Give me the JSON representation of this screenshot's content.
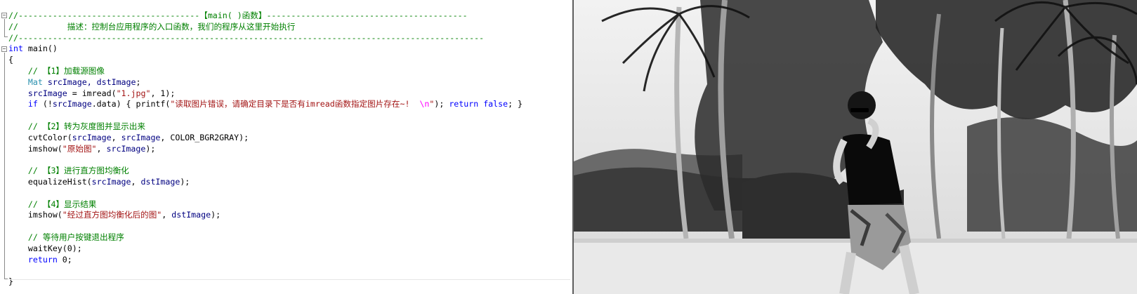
{
  "editor": {
    "fold_markers": [
      "−",
      "−"
    ],
    "lines": [
      {
        "segments": [
          {
            "cls": "c",
            "text": "//-------------------------------------【main( )函数】-----------------------------------------"
          }
        ]
      },
      {
        "segments": [
          {
            "cls": "c",
            "text": "//          描述：控制台应用程序的入口函数，我们的程序从这里开始执行"
          }
        ]
      },
      {
        "segments": [
          {
            "cls": "c",
            "text": "//-----------------------------------------------------------------------------------------------"
          }
        ]
      },
      {
        "segments": [
          {
            "cls": "k",
            "text": "int"
          },
          {
            "cls": "p",
            "text": " main()"
          }
        ]
      },
      {
        "segments": [
          {
            "cls": "p",
            "text": "{"
          }
        ]
      },
      {
        "segments": [
          {
            "cls": "c",
            "text": "    // 【1】加载源图像"
          }
        ]
      },
      {
        "segments": [
          {
            "cls": "t",
            "text": "    Mat"
          },
          {
            "cls": "v",
            "text": " srcImage, dstImage"
          },
          {
            "cls": "p",
            "text": ";"
          }
        ]
      },
      {
        "segments": [
          {
            "cls": "v",
            "text": "    srcImage"
          },
          {
            "cls": "p",
            "text": " = imread("
          },
          {
            "cls": "s",
            "text": "\"1.jpg\""
          },
          {
            "cls": "p",
            "text": ", 1);"
          }
        ]
      },
      {
        "segments": [
          {
            "cls": "k",
            "text": "    if"
          },
          {
            "cls": "p",
            "text": " (!"
          },
          {
            "cls": "v",
            "text": "srcImage"
          },
          {
            "cls": "p",
            "text": ".data) { printf("
          },
          {
            "cls": "s",
            "text": "\"读取图片错误，请确定目录下是否有imread函数指定图片存在~! "
          },
          {
            "cls": "esc",
            "text": " \\n"
          },
          {
            "cls": "s",
            "text": "\""
          },
          {
            "cls": "p",
            "text": "); "
          },
          {
            "cls": "k",
            "text": "return false"
          },
          {
            "cls": "p",
            "text": "; }"
          }
        ]
      },
      {
        "segments": [
          {
            "cls": "p",
            "text": ""
          }
        ]
      },
      {
        "segments": [
          {
            "cls": "c",
            "text": "    // 【2】转为灰度图并显示出来"
          }
        ]
      },
      {
        "segments": [
          {
            "cls": "p",
            "text": "    cvtColor("
          },
          {
            "cls": "v",
            "text": "srcImage"
          },
          {
            "cls": "p",
            "text": ", "
          },
          {
            "cls": "v",
            "text": "srcImage"
          },
          {
            "cls": "p",
            "text": ", COLOR_BGR2GRAY);"
          }
        ]
      },
      {
        "segments": [
          {
            "cls": "p",
            "text": "    imshow("
          },
          {
            "cls": "s",
            "text": "\"原始图\""
          },
          {
            "cls": "p",
            "text": ", "
          },
          {
            "cls": "v",
            "text": "srcImage"
          },
          {
            "cls": "p",
            "text": ");"
          }
        ]
      },
      {
        "segments": [
          {
            "cls": "p",
            "text": ""
          }
        ]
      },
      {
        "segments": [
          {
            "cls": "c",
            "text": "    // 【3】进行直方图均衡化"
          }
        ]
      },
      {
        "segments": [
          {
            "cls": "p",
            "text": "    equalizeHist("
          },
          {
            "cls": "v",
            "text": "srcImage"
          },
          {
            "cls": "p",
            "text": ", "
          },
          {
            "cls": "v",
            "text": "dstImage"
          },
          {
            "cls": "p",
            "text": ");"
          }
        ]
      },
      {
        "segments": [
          {
            "cls": "p",
            "text": ""
          }
        ]
      },
      {
        "segments": [
          {
            "cls": "c",
            "text": "    // 【4】显示结果"
          }
        ]
      },
      {
        "segments": [
          {
            "cls": "p",
            "text": "    imshow("
          },
          {
            "cls": "s",
            "text": "\"经过直方图均衡化后的图\""
          },
          {
            "cls": "p",
            "text": ", "
          },
          {
            "cls": "v",
            "text": "dstImage"
          },
          {
            "cls": "p",
            "text": ");"
          }
        ]
      },
      {
        "segments": [
          {
            "cls": "p",
            "text": ""
          }
        ]
      },
      {
        "segments": [
          {
            "cls": "c",
            "text": "    // 等待用户按键退出程序"
          }
        ]
      },
      {
        "segments": [
          {
            "cls": "p",
            "text": "    waitKey(0);"
          }
        ]
      },
      {
        "segments": [
          {
            "cls": "k",
            "text": "    return"
          },
          {
            "cls": "p",
            "text": " 0;"
          }
        ]
      },
      {
        "segments": [
          {
            "cls": "p",
            "text": ""
          }
        ]
      },
      {
        "segments": [
          {
            "cls": "p",
            "text": "}"
          }
        ]
      }
    ]
  },
  "result_window": {
    "image": "grayscale-photo-person-sitting-on-wall-palm-trees"
  },
  "colors": {
    "comment": "#008000",
    "keyword": "#0000ff",
    "type": "#2b91af",
    "string": "#a31515",
    "escape": "#ff00ff",
    "variable": "#000080"
  }
}
